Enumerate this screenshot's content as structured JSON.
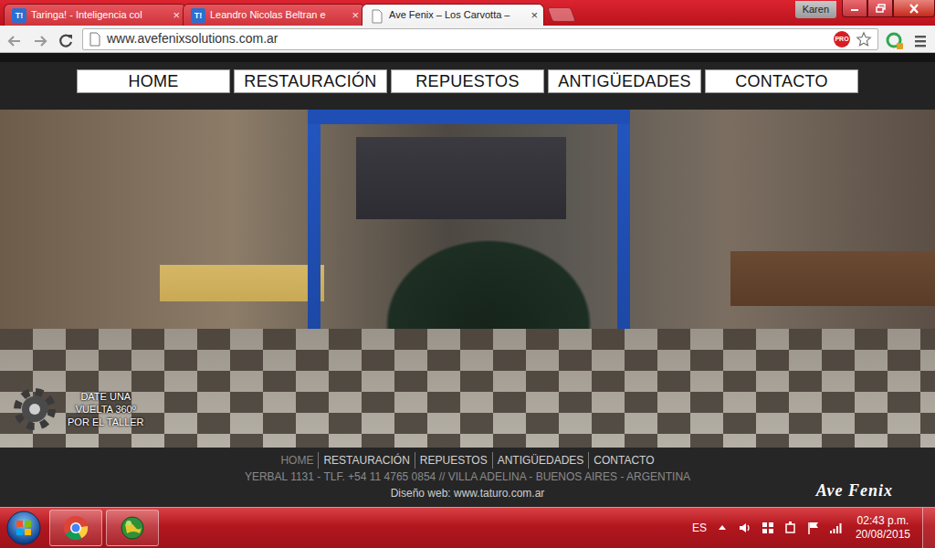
{
  "window": {
    "profile": "Karen"
  },
  "tabs": [
    {
      "kind": "taringa",
      "favicon_text": "T!",
      "label": "Taringa! - Inteligencia col",
      "close": "×",
      "selected": false
    },
    {
      "kind": "taringa",
      "favicon_text": "T!",
      "label": "Leandro Nicolas Beltran e",
      "close": "×",
      "selected": false
    },
    {
      "kind": "page",
      "label": "Ave Fenix – Los Carvotta –",
      "close": "×",
      "selected": true
    }
  ],
  "address_bar": {
    "url": "www.avefenixsolutions.com.ar",
    "extension_badge": "PRO"
  },
  "site": {
    "nav": [
      "HOME",
      "RESTAURACIÓN",
      "REPUESTOS",
      "ANTIGÜEDADES",
      "CONTACTO"
    ],
    "tour": [
      "DATE UNA",
      "VUELTA 360º",
      "POR EL TALLER"
    ],
    "footer": {
      "links": [
        {
          "label": "HOME",
          "selected": true
        },
        {
          "label": "RESTAURACIÓN",
          "selected": false
        },
        {
          "label": "REPUESTOS",
          "selected": false
        },
        {
          "label": "ANTIGÜEDADES",
          "selected": false
        },
        {
          "label": "CONTACTO",
          "selected": false
        }
      ],
      "address": "YERBAL 1131 - TLF. +54 11 4765 0854 // VILLA ADELINA - BUENOS AIRES - ARGENTINA",
      "credit": "Diseño web: www.taturo.com.ar",
      "logo": "Ave Fenix"
    }
  },
  "taskbar": {
    "apps": [
      {
        "kind": "chrome"
      },
      {
        "kind": "globe"
      }
    ],
    "language": "ES",
    "time": "02:43 p.m.",
    "date": "20/08/2015"
  }
}
